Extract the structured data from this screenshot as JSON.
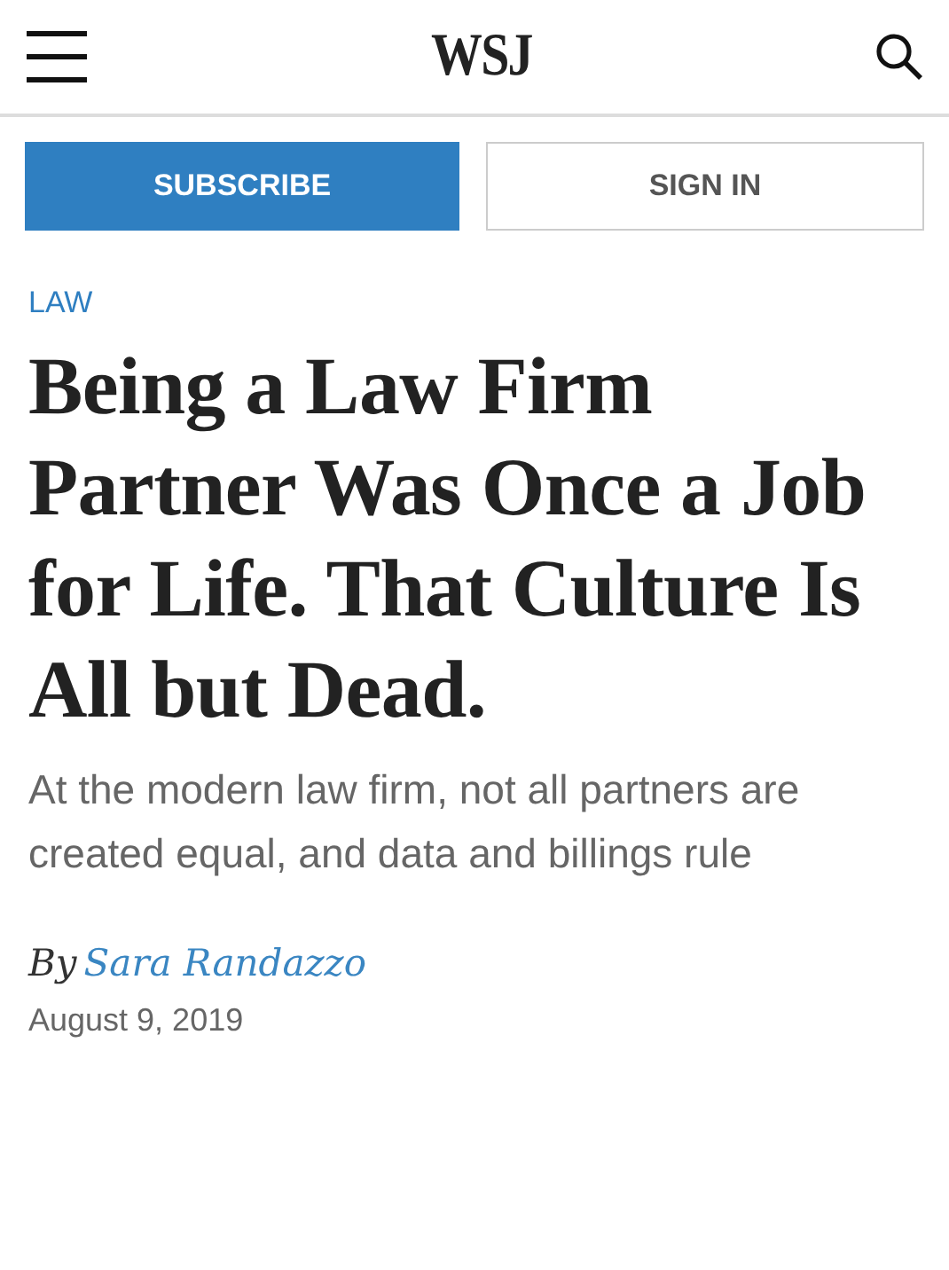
{
  "header": {
    "logo": "WSJ"
  },
  "buttons": [
    {
      "label": "SUBSCRIBE",
      "kind": "primary"
    },
    {
      "label": "SIGN IN",
      "kind": "secondary"
    }
  ],
  "article": {
    "section": "LAW",
    "headline": "Being a Law Firm Partner Was Once a Job for Life. That Culture Is All but Dead.",
    "dek": "At the modern law firm, not all partners are created equal, and data and billings rule",
    "byline": {
      "prefix": "By",
      "author": "Sara Randazzo"
    },
    "date": "August 9, 2019"
  }
}
